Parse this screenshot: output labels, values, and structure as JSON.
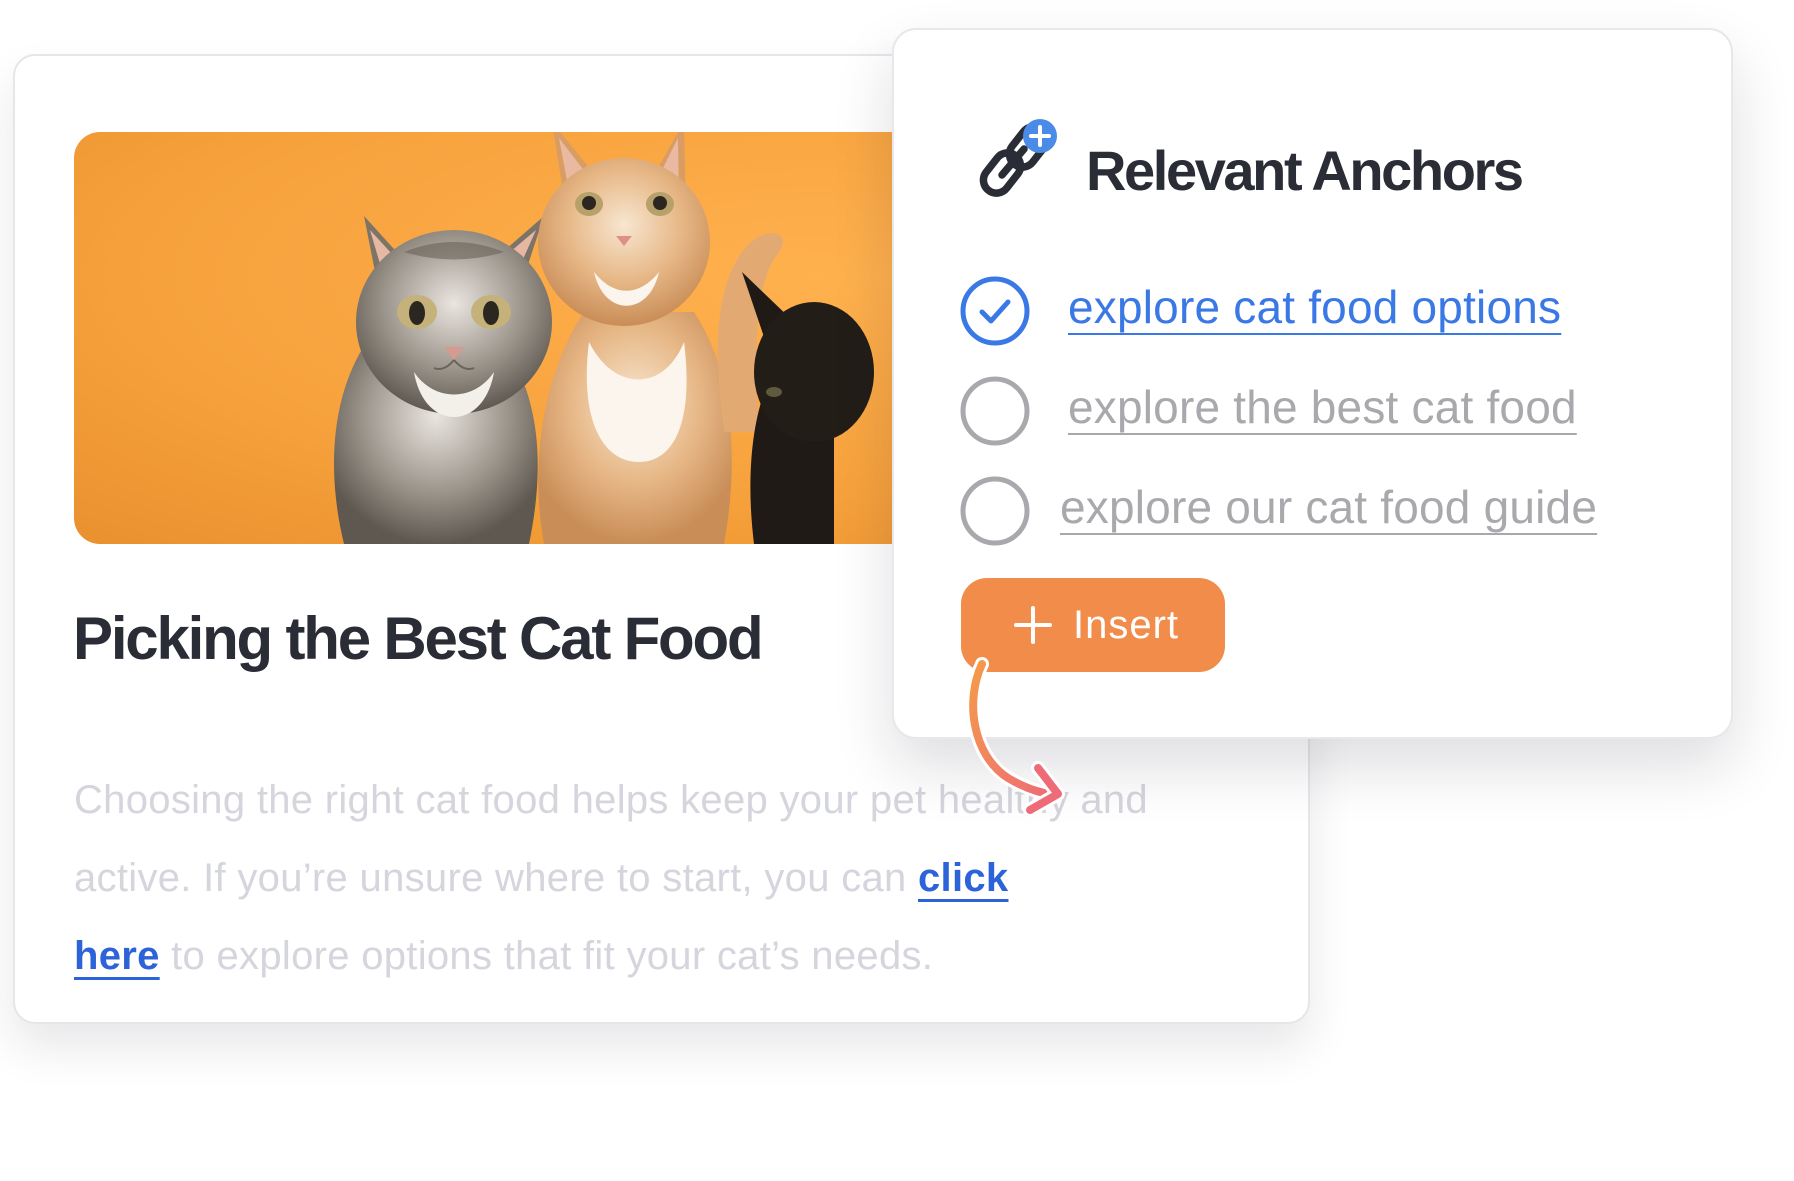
{
  "article": {
    "title": "Picking the Best Cat Food",
    "body_before_link": "Choosing the right cat food helps keep your pet healthy and active. If you’re unsure where to start, you can ",
    "link_text_1": "click",
    "link_text_2": "here",
    "body_after_link": " to explore options that fit your cat’s needs.",
    "image_subject": "three kittens on orange background"
  },
  "anchors_panel": {
    "title": "Relevant Anchors",
    "icon": "link-add-icon",
    "options": [
      {
        "label": "explore cat food options",
        "selected": true
      },
      {
        "label": "explore the best cat food",
        "selected": false
      },
      {
        "label": "explore our cat food guide",
        "selected": false
      }
    ],
    "insert_label": "Insert"
  },
  "colors": {
    "accent_blue": "#3a78e6",
    "link_blue": "#2d63d8",
    "insert_orange": "#f28c4a",
    "hero_orange": "#f6a13c",
    "title_dark": "#2a2d36",
    "muted_text": "#d4d5dd",
    "unselected_gray": "#a9a9ad"
  }
}
